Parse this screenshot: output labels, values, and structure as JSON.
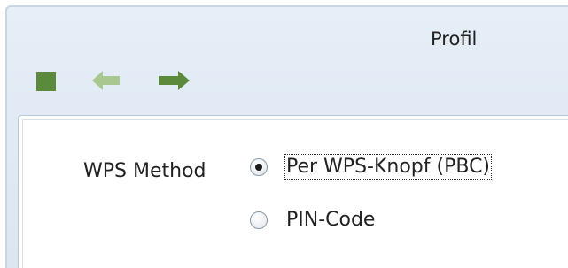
{
  "window": {
    "title": "Profil"
  },
  "toolbar": {
    "icons": [
      "stop-icon",
      "back-arrow-icon",
      "forward-arrow-icon"
    ],
    "colors": {
      "stop": "#5a8a3a",
      "back": "#a8c890",
      "forward": "#5a8a3a"
    }
  },
  "wps": {
    "label": "WPS Method",
    "options": [
      {
        "label": "Per WPS-Knopf (PBC)",
        "selected": true,
        "focused": true
      },
      {
        "label": "PIN-Code",
        "selected": false,
        "focused": false
      }
    ]
  }
}
